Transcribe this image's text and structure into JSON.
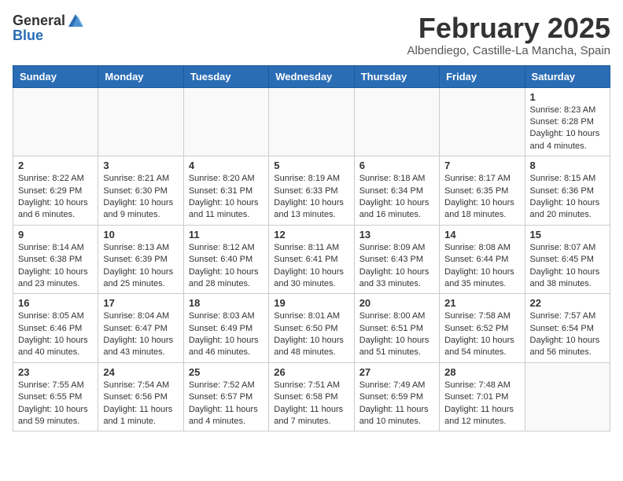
{
  "header": {
    "logo_general": "General",
    "logo_blue": "Blue",
    "month_title": "February 2025",
    "subtitle": "Albendiego, Castille-La Mancha, Spain"
  },
  "weekdays": [
    "Sunday",
    "Monday",
    "Tuesday",
    "Wednesday",
    "Thursday",
    "Friday",
    "Saturday"
  ],
  "weeks": [
    [
      {
        "day": "",
        "info": ""
      },
      {
        "day": "",
        "info": ""
      },
      {
        "day": "",
        "info": ""
      },
      {
        "day": "",
        "info": ""
      },
      {
        "day": "",
        "info": ""
      },
      {
        "day": "",
        "info": ""
      },
      {
        "day": "1",
        "info": "Sunrise: 8:23 AM\nSunset: 6:28 PM\nDaylight: 10 hours\nand 4 minutes."
      }
    ],
    [
      {
        "day": "2",
        "info": "Sunrise: 8:22 AM\nSunset: 6:29 PM\nDaylight: 10 hours\nand 6 minutes."
      },
      {
        "day": "3",
        "info": "Sunrise: 8:21 AM\nSunset: 6:30 PM\nDaylight: 10 hours\nand 9 minutes."
      },
      {
        "day": "4",
        "info": "Sunrise: 8:20 AM\nSunset: 6:31 PM\nDaylight: 10 hours\nand 11 minutes."
      },
      {
        "day": "5",
        "info": "Sunrise: 8:19 AM\nSunset: 6:33 PM\nDaylight: 10 hours\nand 13 minutes."
      },
      {
        "day": "6",
        "info": "Sunrise: 8:18 AM\nSunset: 6:34 PM\nDaylight: 10 hours\nand 16 minutes."
      },
      {
        "day": "7",
        "info": "Sunrise: 8:17 AM\nSunset: 6:35 PM\nDaylight: 10 hours\nand 18 minutes."
      },
      {
        "day": "8",
        "info": "Sunrise: 8:15 AM\nSunset: 6:36 PM\nDaylight: 10 hours\nand 20 minutes."
      }
    ],
    [
      {
        "day": "9",
        "info": "Sunrise: 8:14 AM\nSunset: 6:38 PM\nDaylight: 10 hours\nand 23 minutes."
      },
      {
        "day": "10",
        "info": "Sunrise: 8:13 AM\nSunset: 6:39 PM\nDaylight: 10 hours\nand 25 minutes."
      },
      {
        "day": "11",
        "info": "Sunrise: 8:12 AM\nSunset: 6:40 PM\nDaylight: 10 hours\nand 28 minutes."
      },
      {
        "day": "12",
        "info": "Sunrise: 8:11 AM\nSunset: 6:41 PM\nDaylight: 10 hours\nand 30 minutes."
      },
      {
        "day": "13",
        "info": "Sunrise: 8:09 AM\nSunset: 6:43 PM\nDaylight: 10 hours\nand 33 minutes."
      },
      {
        "day": "14",
        "info": "Sunrise: 8:08 AM\nSunset: 6:44 PM\nDaylight: 10 hours\nand 35 minutes."
      },
      {
        "day": "15",
        "info": "Sunrise: 8:07 AM\nSunset: 6:45 PM\nDaylight: 10 hours\nand 38 minutes."
      }
    ],
    [
      {
        "day": "16",
        "info": "Sunrise: 8:05 AM\nSunset: 6:46 PM\nDaylight: 10 hours\nand 40 minutes."
      },
      {
        "day": "17",
        "info": "Sunrise: 8:04 AM\nSunset: 6:47 PM\nDaylight: 10 hours\nand 43 minutes."
      },
      {
        "day": "18",
        "info": "Sunrise: 8:03 AM\nSunset: 6:49 PM\nDaylight: 10 hours\nand 46 minutes."
      },
      {
        "day": "19",
        "info": "Sunrise: 8:01 AM\nSunset: 6:50 PM\nDaylight: 10 hours\nand 48 minutes."
      },
      {
        "day": "20",
        "info": "Sunrise: 8:00 AM\nSunset: 6:51 PM\nDaylight: 10 hours\nand 51 minutes."
      },
      {
        "day": "21",
        "info": "Sunrise: 7:58 AM\nSunset: 6:52 PM\nDaylight: 10 hours\nand 54 minutes."
      },
      {
        "day": "22",
        "info": "Sunrise: 7:57 AM\nSunset: 6:54 PM\nDaylight: 10 hours\nand 56 minutes."
      }
    ],
    [
      {
        "day": "23",
        "info": "Sunrise: 7:55 AM\nSunset: 6:55 PM\nDaylight: 10 hours\nand 59 minutes."
      },
      {
        "day": "24",
        "info": "Sunrise: 7:54 AM\nSunset: 6:56 PM\nDaylight: 11 hours\nand 1 minute."
      },
      {
        "day": "25",
        "info": "Sunrise: 7:52 AM\nSunset: 6:57 PM\nDaylight: 11 hours\nand 4 minutes."
      },
      {
        "day": "26",
        "info": "Sunrise: 7:51 AM\nSunset: 6:58 PM\nDaylight: 11 hours\nand 7 minutes."
      },
      {
        "day": "27",
        "info": "Sunrise: 7:49 AM\nSunset: 6:59 PM\nDaylight: 11 hours\nand 10 minutes."
      },
      {
        "day": "28",
        "info": "Sunrise: 7:48 AM\nSunset: 7:01 PM\nDaylight: 11 hours\nand 12 minutes."
      },
      {
        "day": "",
        "info": ""
      }
    ]
  ]
}
